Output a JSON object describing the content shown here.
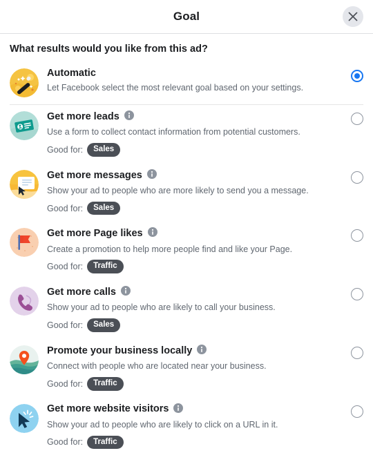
{
  "header": {
    "title": "Goal",
    "close_label": "Close",
    "close_icon": "close-icon"
  },
  "question": "What results would you like from this ad?",
  "labels": {
    "good_for": "Good for:",
    "info_icon": "info-icon"
  },
  "colors": {
    "accent": "#1877f2",
    "badge_bg": "#4b4f56",
    "divider": "#e5e5e5",
    "text_primary": "#1c1e21",
    "text_secondary": "#606770",
    "close_bg": "#e4e6eb"
  },
  "options": [
    {
      "id": "automatic",
      "title": "Automatic",
      "description": "Let Facebook select the most relevant goal based on your settings.",
      "icon": "magic-wand-icon",
      "has_info": false,
      "good_for": null,
      "selected": true
    },
    {
      "id": "get-more-leads",
      "title": "Get more leads",
      "description": "Use a form to collect contact information from potential customers.",
      "icon": "contact-card-icon",
      "has_info": true,
      "good_for": "Sales",
      "selected": false
    },
    {
      "id": "get-more-messages",
      "title": "Get more messages",
      "description": "Show your ad to people who are more likely to send you a message.",
      "icon": "message-bubble-icon",
      "has_info": true,
      "good_for": "Sales",
      "selected": false
    },
    {
      "id": "get-more-page-likes",
      "title": "Get more Page likes",
      "description": "Create a promotion to help more people find and like your Page.",
      "icon": "flag-icon",
      "has_info": true,
      "good_for": "Traffic",
      "selected": false
    },
    {
      "id": "get-more-calls",
      "title": "Get more calls",
      "description": "Show your ad to people who are likely to call your business.",
      "icon": "phone-icon",
      "has_info": true,
      "good_for": "Sales",
      "selected": false
    },
    {
      "id": "promote-business-locally",
      "title": "Promote your business locally",
      "description": "Connect with people who are located near your business.",
      "icon": "map-pin-icon",
      "has_info": true,
      "good_for": "Traffic",
      "selected": false
    },
    {
      "id": "get-more-website-visitors",
      "title": "Get more website visitors",
      "description": "Show your ad to people who are likely to click on a URL in it.",
      "icon": "cursor-click-icon",
      "has_info": true,
      "good_for": "Traffic",
      "selected": false
    }
  ]
}
